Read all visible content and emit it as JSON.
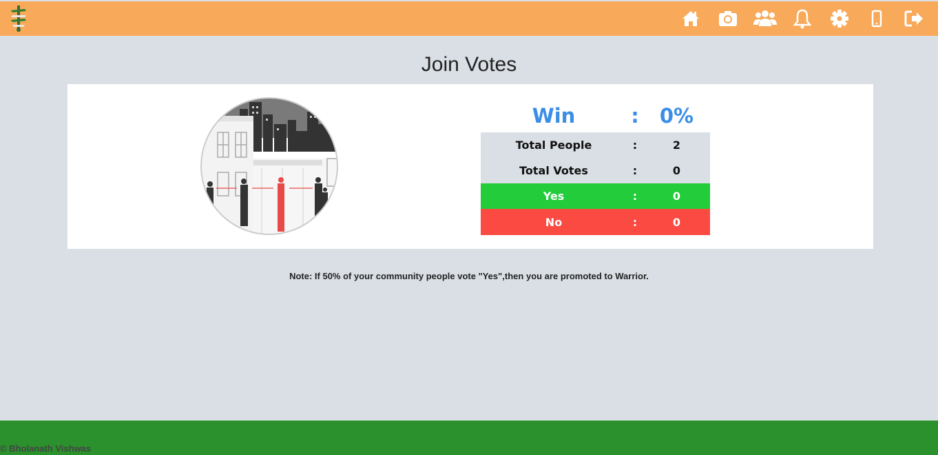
{
  "header": {
    "logo_icon": "pole-signal-icon",
    "nav": [
      {
        "icon": "home-icon"
      },
      {
        "icon": "camera-icon"
      },
      {
        "icon": "group-icon"
      },
      {
        "icon": "bell-icon"
      },
      {
        "icon": "gear-icon"
      },
      {
        "icon": "mobile-icon"
      },
      {
        "icon": "sign-out-icon"
      }
    ]
  },
  "page": {
    "title": "Join Votes"
  },
  "stats": {
    "win": {
      "label": "Win",
      "sep": ":",
      "value": "0%"
    },
    "rows": [
      {
        "label": "Total People",
        "sep": ":",
        "value": "2"
      },
      {
        "label": "Total Votes",
        "sep": ":",
        "value": "0"
      },
      {
        "label": "Yes",
        "sep": ":",
        "value": "0"
      },
      {
        "label": "No",
        "sep": ":",
        "value": "0"
      }
    ]
  },
  "note": "Note: If 50% of your community people vote \"Yes\",then you are promoted to Warrior.",
  "footer": {
    "copyright": "© Bholanath Vishwas"
  },
  "colors": {
    "header": "#f8a959",
    "footer": "#2a912d",
    "win_text": "#3a8ee6",
    "yes": "#22cc3a",
    "no": "#fa4a42",
    "background": "#dadfe5"
  }
}
